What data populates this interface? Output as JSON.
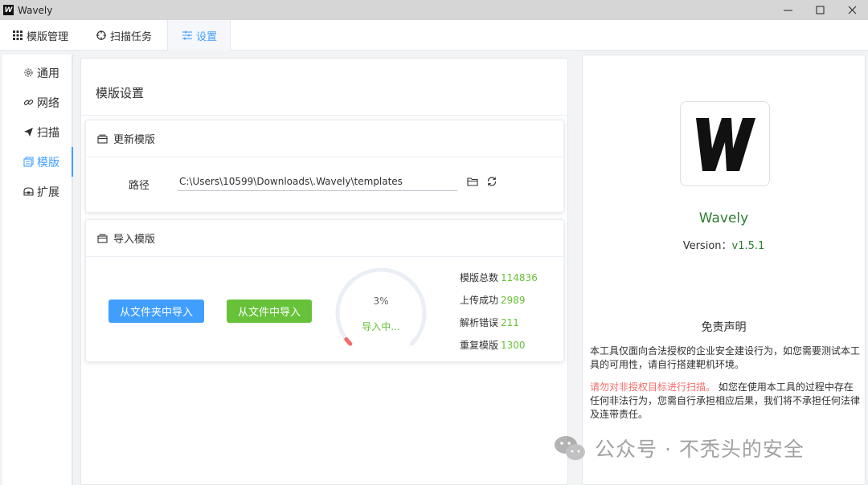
{
  "window": {
    "title": "Wavely",
    "icon_letter": "W"
  },
  "tabs": [
    {
      "label": "模版管理",
      "icon": "grid-icon"
    },
    {
      "label": "扫描任务",
      "icon": "target-icon"
    },
    {
      "label": "设置",
      "icon": "sliders-icon"
    }
  ],
  "nav": [
    {
      "label": "通用",
      "icon": "gear-icon"
    },
    {
      "label": "网络",
      "icon": "link-icon"
    },
    {
      "label": "扫描",
      "icon": "send-icon"
    },
    {
      "label": "模版",
      "icon": "template-icon"
    },
    {
      "label": "扩展",
      "icon": "extension-icon"
    }
  ],
  "main": {
    "title": "模版设置",
    "update_card": {
      "title": "更新模版",
      "path_label": "路径",
      "path_value": "C:\\Users\\10599\\Downloads\\.Wavely\\templates"
    },
    "import_card": {
      "title": "导入模版",
      "btn_from_folder": "从文件夹中导入",
      "btn_from_file": "从文件中导入",
      "progress_percent": 3,
      "progress_label": "3%",
      "progress_status": "导入中...",
      "stats": [
        {
          "label": "模版总数",
          "value": "114836"
        },
        {
          "label": "上传成功",
          "value": "2989"
        },
        {
          "label": "解析错误",
          "value": "211"
        },
        {
          "label": "重复模版",
          "value": "1300"
        }
      ]
    }
  },
  "about": {
    "app_name": "Wavely",
    "version_label": "Version：",
    "version_value": "v1.5.1",
    "disclaimer_title": "免责声明",
    "disclaimer_p1": "本工具仅面向合法授权的企业安全建设行为，如您需要测试本工具的可用性，请自行搭建靶机环境。",
    "disclaimer_warn": "请勿对非授权目标进行扫描。",
    "disclaimer_p2": " 如您在使用本工具的过程中存在任何非法行为，您需自行承担相应后果，我们将不承担任何法律及连带责任。"
  },
  "watermark": {
    "text": "公众号 · 不秃头的安全"
  },
  "colors": {
    "accent": "#409eff",
    "success": "#67c23a",
    "danger": "#f56c6c",
    "brand_green": "#2e7d32"
  }
}
